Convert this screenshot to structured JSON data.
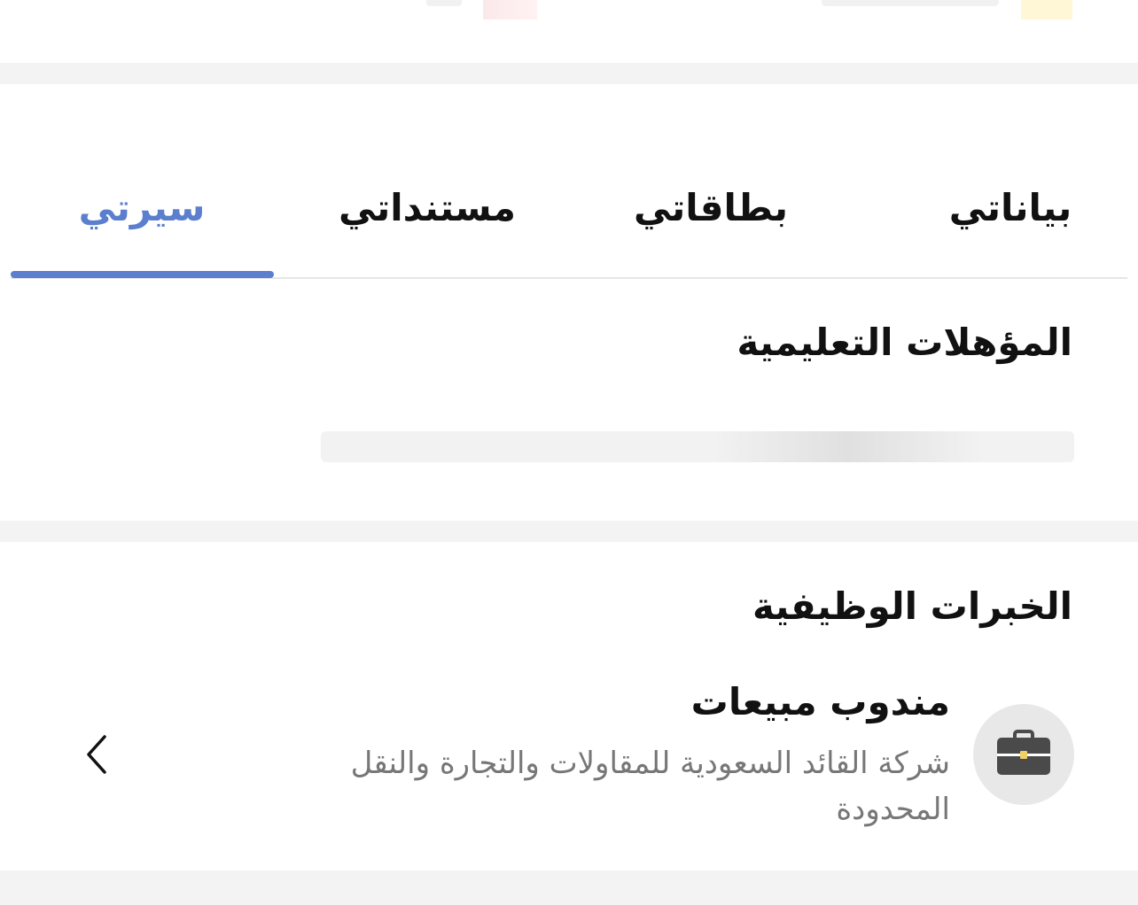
{
  "tabs": [
    {
      "label": "بياناتي"
    },
    {
      "label": "بطاقاتي"
    },
    {
      "label": "مستنداتي"
    },
    {
      "label": "سيرتي"
    }
  ],
  "active_tab": "سيرتي",
  "education": {
    "title": "المؤهلات التعليمية"
  },
  "experience": {
    "title": "الخبرات الوظيفية",
    "items": [
      {
        "job_title": "مندوب مبيعات",
        "company": "شركة القائد السعودية للمقاولات والتجارة والنقل المحدودة",
        "icon": "briefcase-icon"
      }
    ]
  },
  "colors": {
    "accent": "#5b7fce",
    "separator": "#f3f3f3",
    "muted_text": "#777777"
  }
}
